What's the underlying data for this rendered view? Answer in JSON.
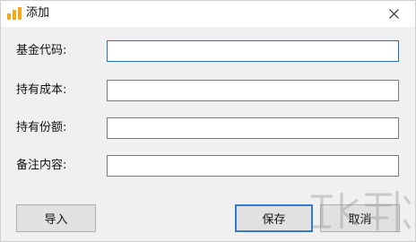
{
  "window": {
    "title": "添加",
    "close_glyph": "✕"
  },
  "fields": [
    {
      "label": "基金代码:",
      "value": "",
      "placeholder": ""
    },
    {
      "label": "持有成本:",
      "value": "",
      "placeholder": ""
    },
    {
      "label": "持有份额:",
      "value": "",
      "placeholder": ""
    },
    {
      "label": "备注内容:",
      "value": "",
      "placeholder": ""
    }
  ],
  "buttons": {
    "import_label": "导入",
    "save_label": "保存",
    "cancel_label": "取消"
  },
  "icons": {
    "app": "bar-chart-icon",
    "close": "close-icon"
  },
  "colors": {
    "app_icon": "#f2a81d",
    "focus_border": "#2a6fbd",
    "default_button_border": "#2f7bd4"
  }
}
